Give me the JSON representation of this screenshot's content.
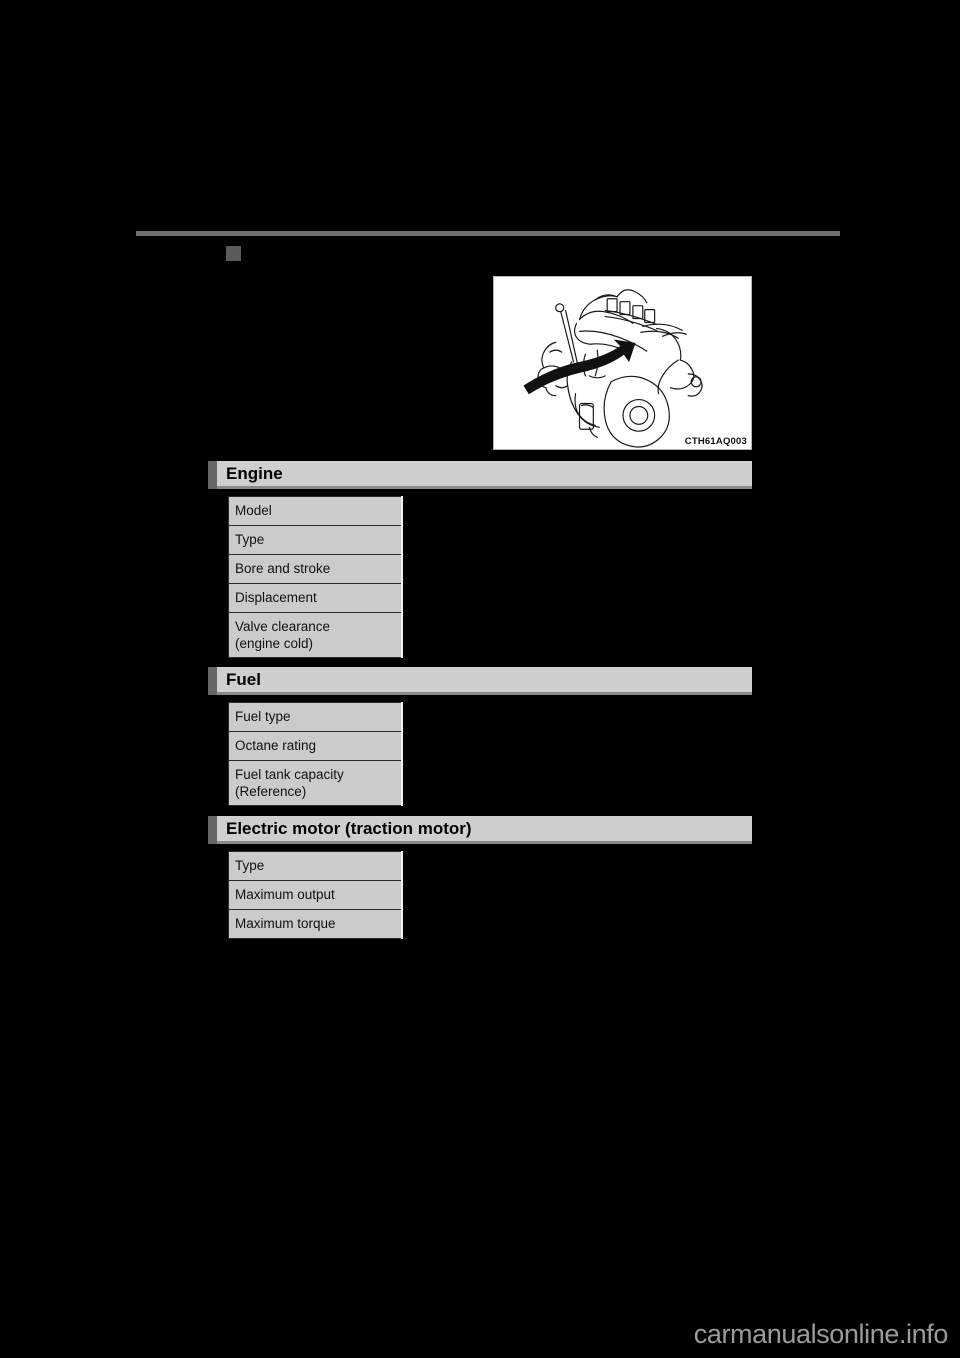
{
  "page": {
    "background_color": "#000000",
    "rule_color": "#6e6e6e",
    "bullet_color": "#5a5a5a",
    "header_bar_color": "#cfcfcf",
    "header_tab_color": "#666666",
    "cell_fill_color": "#cbcbcb",
    "watermark": "carmanualsonline.info"
  },
  "figure": {
    "caption_code": "CTH61AQ003",
    "alt": "engine-line-drawing-with-arrow"
  },
  "sections": [
    {
      "id": "engine",
      "title": "Engine",
      "rows": [
        {
          "label": "Model",
          "label2": ""
        },
        {
          "label": "Type",
          "label2": ""
        },
        {
          "label": "Bore and stroke",
          "label2": ""
        },
        {
          "label": "Displacement",
          "label2": ""
        },
        {
          "label": "Valve clearance",
          "label2": "(engine cold)"
        }
      ]
    },
    {
      "id": "fuel",
      "title": "Fuel",
      "rows": [
        {
          "label": "Fuel type",
          "label2": ""
        },
        {
          "label": "Octane rating",
          "label2": ""
        },
        {
          "label": "Fuel tank capacity",
          "label2": "(Reference)"
        }
      ]
    },
    {
      "id": "electric-motor",
      "title": "Electric motor (traction motor)",
      "rows": [
        {
          "label": "Type",
          "label2": ""
        },
        {
          "label": "Maximum output",
          "label2": ""
        },
        {
          "label": "Maximum torque",
          "label2": ""
        }
      ]
    }
  ]
}
